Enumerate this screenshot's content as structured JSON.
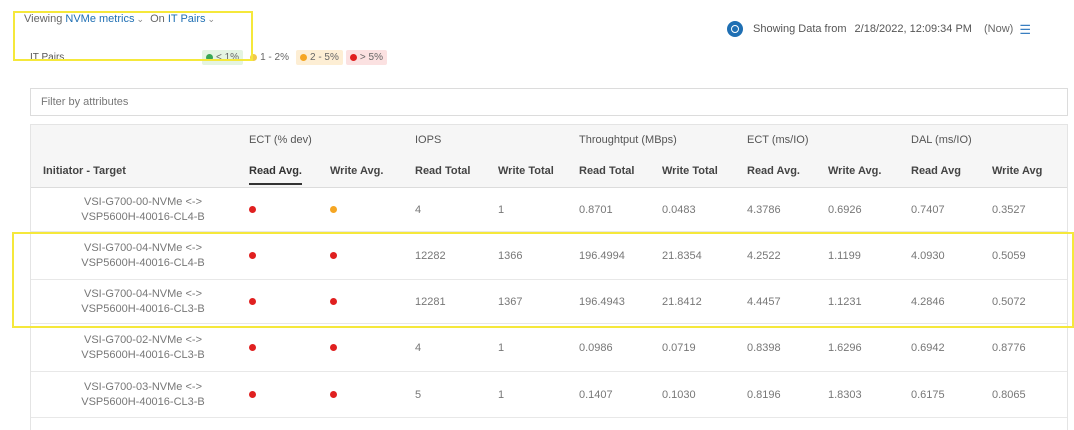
{
  "header": {
    "viewing_prefix": "Viewing",
    "metric_selector": "NVMe metrics",
    "on_prefix": "On",
    "entity_selector": "IT Pairs",
    "legend_label": "IT Pairs",
    "legend": [
      {
        "label": "< 1%",
        "color": "#3aa655",
        "bg": "#e4f4e1"
      },
      {
        "label": "1 - 2%",
        "color": "#f2c94c",
        "bg": "#ffffff"
      },
      {
        "label": "2 - 5%",
        "color": "#f5a623",
        "bg": "#fdeed4"
      },
      {
        "label": "> 5%",
        "color": "#e02020",
        "bg": "#fbe1e1"
      }
    ],
    "showing_label": "Showing Data from",
    "timestamp": "2/18/2022, 12:09:34 PM",
    "now_label": "(Now)"
  },
  "filter": {
    "placeholder": "Filter by attributes"
  },
  "table": {
    "groups": [
      {
        "label": "ECT (% dev)"
      },
      {
        "label": "IOPS"
      },
      {
        "label": "Throughtput (MBps)"
      },
      {
        "label": "ECT (ms/IO)"
      },
      {
        "label": "DAL (ms/IO)"
      }
    ],
    "columns": [
      "Initiator - Target",
      "Read Avg.",
      "Write Avg.",
      "Read Total",
      "Write Total",
      "Read Total",
      "Write Total",
      "Read Avg.",
      "Write Avg.",
      "Read Avg",
      "Write Avg"
    ],
    "rows": [
      {
        "initiator": "VSI-G700-00-NVMe <->",
        "target": "VSP5600H-40016-CL4-B",
        "ect_read": "red",
        "ect_write": "orange",
        "iops_read": "4",
        "iops_write": "1",
        "tp_read": "0.8701",
        "tp_write": "0.0483",
        "ectms_read": "4.3786",
        "ectms_write": "0.6926",
        "dal_read": "0.7407",
        "dal_write": "0.3527"
      },
      {
        "initiator": "VSI-G700-04-NVMe <->",
        "target": "VSP5600H-40016-CL4-B",
        "ect_read": "red",
        "ect_write": "red",
        "iops_read": "12282",
        "iops_write": "1366",
        "tp_read": "196.4994",
        "tp_write": "21.8354",
        "ectms_read": "4.2522",
        "ectms_write": "1.1199",
        "dal_read": "4.0930",
        "dal_write": "0.5059"
      },
      {
        "initiator": "VSI-G700-04-NVMe <->",
        "target": "VSP5600H-40016-CL3-B",
        "ect_read": "red",
        "ect_write": "red",
        "iops_read": "12281",
        "iops_write": "1367",
        "tp_read": "196.4943",
        "tp_write": "21.8412",
        "ectms_read": "4.4457",
        "ectms_write": "1.1231",
        "dal_read": "4.2846",
        "dal_write": "0.5072"
      },
      {
        "initiator": "VSI-G700-02-NVMe <->",
        "target": "VSP5600H-40016-CL3-B",
        "ect_read": "red",
        "ect_write": "red",
        "iops_read": "4",
        "iops_write": "1",
        "tp_read": "0.0986",
        "tp_write": "0.0719",
        "ectms_read": "0.8398",
        "ectms_write": "1.6296",
        "dal_read": "0.6942",
        "dal_write": "0.8776"
      },
      {
        "initiator": "VSI-G700-03-NVMe <->",
        "target": "VSP5600H-40016-CL3-B",
        "ect_read": "red",
        "ect_write": "red",
        "iops_read": "5",
        "iops_write": "1",
        "tp_read": "0.1407",
        "tp_write": "0.1030",
        "ectms_read": "0.8196",
        "ectms_write": "1.8303",
        "dal_read": "0.6175",
        "dal_write": "0.8065"
      }
    ],
    "status_colors": {
      "red": "#e02020",
      "orange": "#f5a623"
    },
    "selected_rows": [
      1,
      2
    ]
  }
}
